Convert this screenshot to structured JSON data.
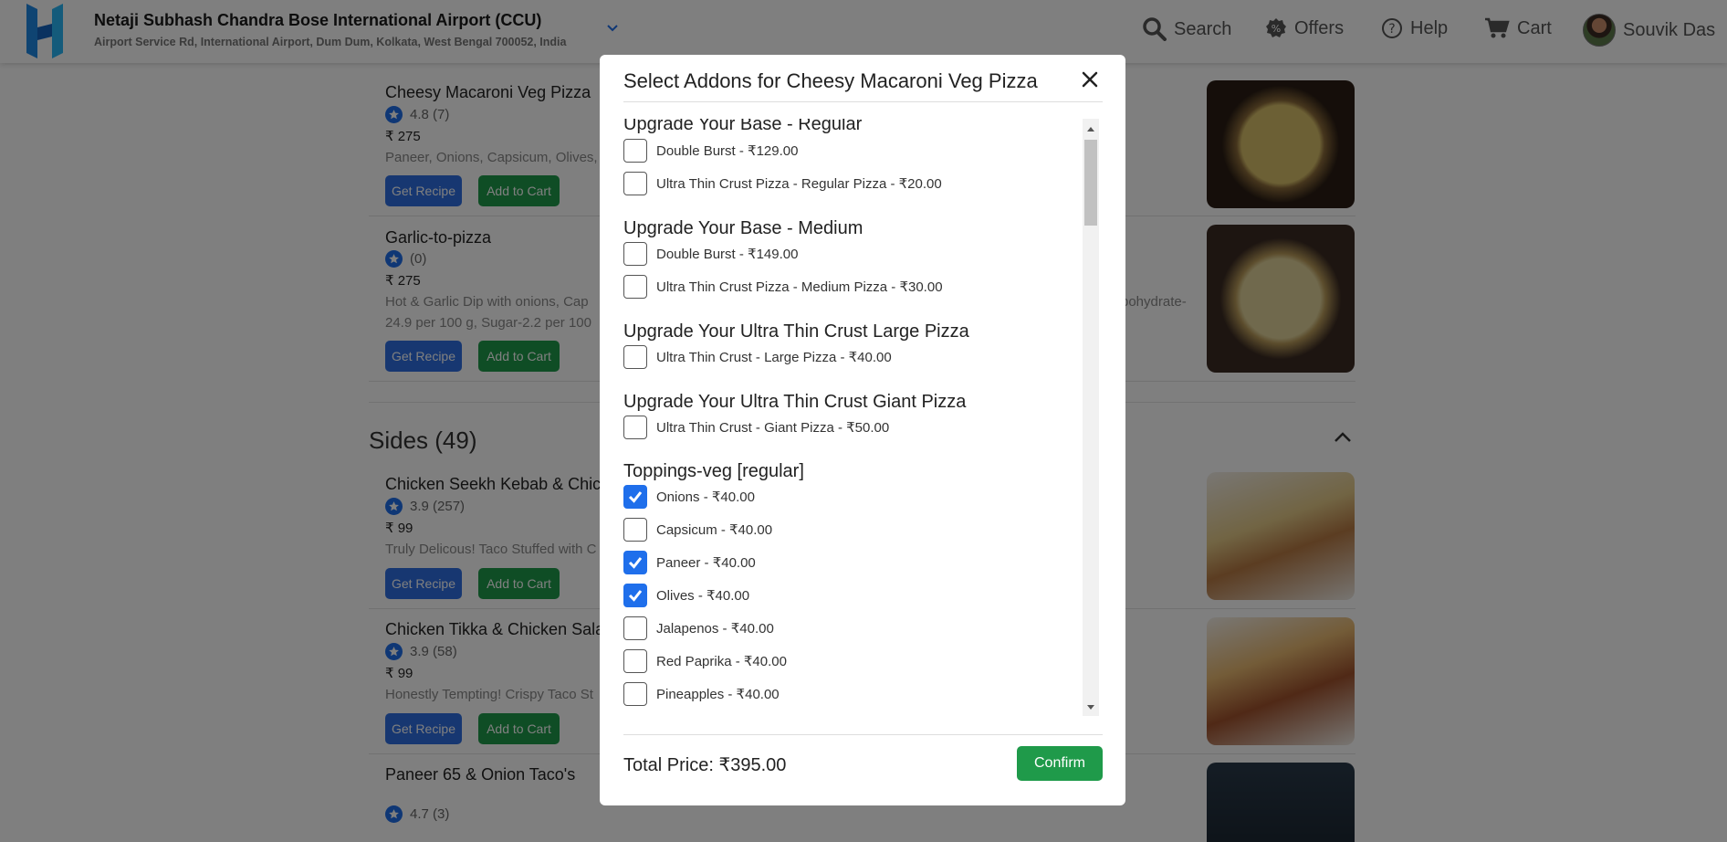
{
  "header": {
    "location_name": "Netaji Subhash Chandra Bose International Airport (CCU)",
    "location_address": "Airport Service Rd, International Airport, Dum Dum, Kolkata, West Bengal 700052, India",
    "nav": {
      "search": "Search",
      "offers": "Offers",
      "help": "Help",
      "cart": "Cart",
      "user": "Souvik Das"
    }
  },
  "background": {
    "items": [
      {
        "title": "Cheesy Macaroni Veg Pizza",
        "rating": "4.8 (7)",
        "price": "₹ 275",
        "desc": "Paneer, Onions, Capsicum, Olives,",
        "recipe": "Get Recipe",
        "cart": "Add to Cart"
      },
      {
        "title": "Garlic-to-pizza",
        "rating": "(0)",
        "price": "₹ 275",
        "desc": "Hot & Garlic Dip with onions, Cap",
        "desc2": "24.9 per 100 g, Sugar-2.2 per 100",
        "desc_right": "bohydrate-",
        "recipe": "Get Recipe",
        "cart": "Add to Cart"
      },
      {
        "title": "Chicken Seekh Kebab & Chick",
        "rating": "3.9 (257)",
        "price": "₹ 99",
        "desc": "Truly Delicous! Taco Stuffed with C",
        "recipe": "Get Recipe",
        "cart": "Add to Cart"
      },
      {
        "title": "Chicken Tikka & Chicken Sala",
        "rating": "3.9 (58)",
        "price": "₹ 99",
        "desc": "Honestly Tempting! Crispy Taco St",
        "recipe": "Get Recipe",
        "cart": "Add to Cart"
      },
      {
        "title": "Paneer 65 & Onion Taco's",
        "rating": "4.7 (3)"
      }
    ],
    "section": "Sides (49)"
  },
  "modal": {
    "title": "Select Addons for Cheesy Macaroni Veg Pizza",
    "groups": [
      {
        "title": "Upgrade Your Base - Regular",
        "options": [
          {
            "label": "Double Burst - ₹129.00",
            "checked": false
          },
          {
            "label": "Ultra Thin Crust Pizza - Regular Pizza - ₹20.00",
            "checked": false
          }
        ]
      },
      {
        "title": "Upgrade Your Base - Medium",
        "options": [
          {
            "label": "Double Burst - ₹149.00",
            "checked": false
          },
          {
            "label": "Ultra Thin Crust Pizza - Medium Pizza - ₹30.00",
            "checked": false
          }
        ]
      },
      {
        "title": "Upgrade Your Ultra Thin Crust Large Pizza",
        "options": [
          {
            "label": "Ultra Thin Crust - Large Pizza - ₹40.00",
            "checked": false
          }
        ]
      },
      {
        "title": "Upgrade Your Ultra Thin Crust Giant Pizza",
        "options": [
          {
            "label": "Ultra Thin Crust - Giant Pizza - ₹50.00",
            "checked": false
          }
        ]
      },
      {
        "title": "Toppings-veg [regular]",
        "options": [
          {
            "label": "Onions - ₹40.00",
            "checked": true
          },
          {
            "label": "Capsicum - ₹40.00",
            "checked": false
          },
          {
            "label": "Paneer - ₹40.00",
            "checked": true
          },
          {
            "label": "Olives - ₹40.00",
            "checked": true
          },
          {
            "label": "Jalapenos - ₹40.00",
            "checked": false
          },
          {
            "label": "Red Paprika - ₹40.00",
            "checked": false
          },
          {
            "label": "Pineapples - ₹40.00",
            "checked": false
          }
        ]
      }
    ],
    "total_label": "Total Price: ₹395.00",
    "confirm_label": "Confirm"
  },
  "colors": {
    "primary": "#1f6feb",
    "confirm": "#1f9a4a",
    "logo": "#1e88e5"
  }
}
